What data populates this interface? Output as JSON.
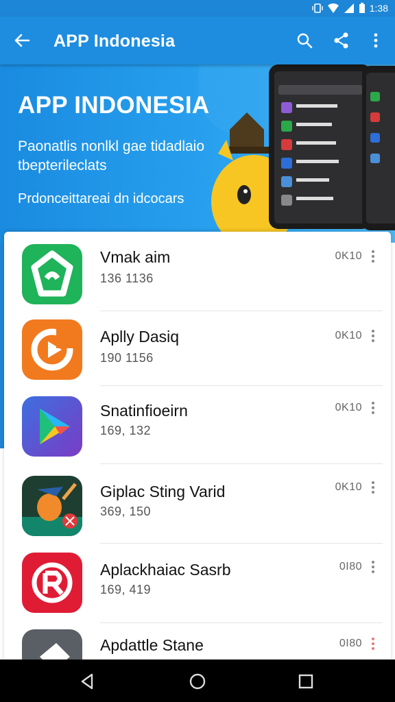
{
  "status_bar": {
    "time": "1:38"
  },
  "toolbar": {
    "title": "APP Indonesia"
  },
  "hero": {
    "title": "APP INDONESIA",
    "subtitle_line1": "Paonatlis nonlkl gae tidadlaio",
    "subtitle_line2": "tbepterileclats",
    "subtitle_line3": "Prdonceittareai dn idcocars"
  },
  "apps": [
    {
      "name": "Vmak aim",
      "meta": "136 1136",
      "size": "0K10",
      "icon": "green-app-icon",
      "color": "#1fb35a"
    },
    {
      "name": "Aplly Dasiq",
      "meta": "190 1156",
      "size": "0K10",
      "icon": "orange-play-icon",
      "color": "#f27a1e"
    },
    {
      "name": "Snatinfioeirn",
      "meta": "169, 132",
      "size": "0K10",
      "icon": "play-store-icon",
      "color": "#5a46c8"
    },
    {
      "name": "Giplac Sting Varid",
      "meta": "369, 150",
      "size": "0K10",
      "icon": "game-character-icon",
      "color": "#1e3e32"
    },
    {
      "name": "Aplackhaiac Sasrb",
      "meta": "169, 419",
      "size": "0I80",
      "icon": "red-r-icon",
      "color": "#e01c35"
    },
    {
      "name": "Apdattle Stane",
      "meta": "",
      "size": "0I80",
      "icon": "grey-app-icon",
      "color": "#5a5f66"
    }
  ],
  "colors": {
    "primary": "#1e8de0",
    "status": "#1e86d6"
  }
}
